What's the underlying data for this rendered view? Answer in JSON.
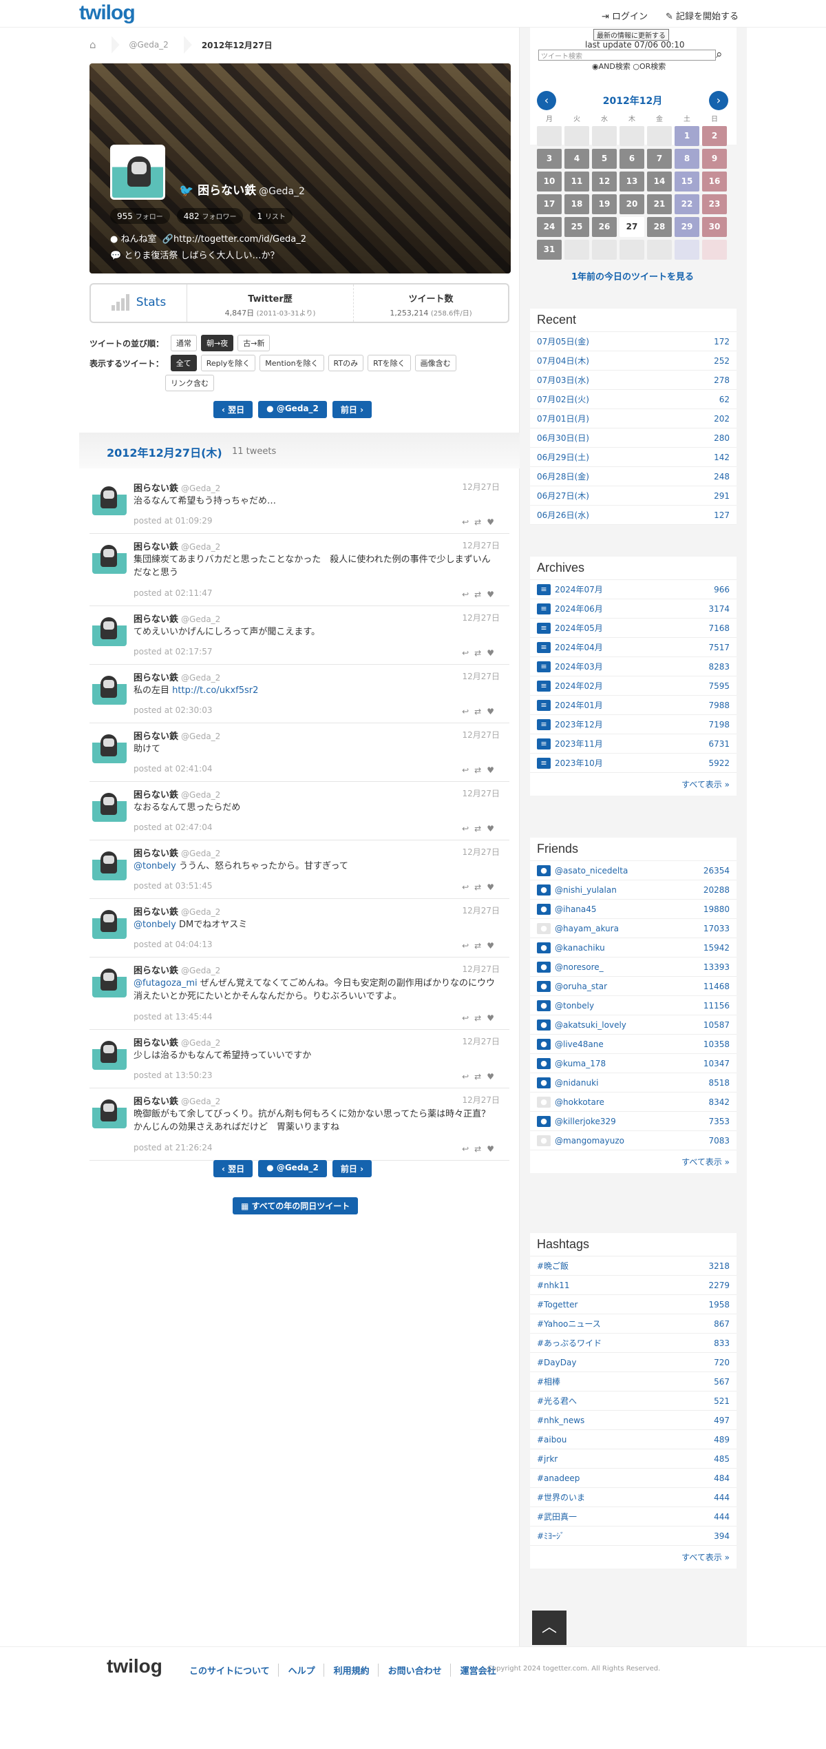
{
  "header": {
    "logo": "twilog",
    "login": "ログイン",
    "start": "記録を開始する"
  },
  "breadcrumb": {
    "user": "@Geda_2",
    "date": "2012年12月27日"
  },
  "profile": {
    "name": "困らない鉄",
    "handle": "@Geda_2",
    "followers_count": "955",
    "followers_label": "フォロー",
    "following_count": "482",
    "following_label": "フォロワー",
    "lists_count": "1",
    "lists_label": "リスト",
    "location": "ねんね室",
    "url": "http://togetter.com/id/Geda_2",
    "bio": "とりま復活祭 しばらく大人しい…か？"
  },
  "stats": {
    "label": "Stats",
    "history_title": "Twitter歴",
    "history_value": "4,847日",
    "history_note": "(2011-03-31より)",
    "count_title": "ツイート数",
    "count_value": "1,253,214",
    "count_note": "(258.6件/日)"
  },
  "options": {
    "order_label": "ツイートの並び順：",
    "order": [
      "通常",
      "朝→夜",
      "古→新"
    ],
    "filter_label": "表示するツイート：",
    "filters": [
      "全て",
      "Replyを除く",
      "Mentionを除く",
      "RTのみ",
      "RTを除く",
      "画像含む",
      "リンク含む"
    ]
  },
  "nav": {
    "prev": "翌日",
    "user": "@Geda_2",
    "next": "前日",
    "all_years": "すべての年の同日ツイート"
  },
  "day": {
    "title": "2012年12月27日(木)",
    "count": "11 tweets"
  },
  "tweets": [
    {
      "name": "困らない鉄",
      "handle": "@Geda_2",
      "date": "12月27日",
      "text": "治るなんて希望もう持っちゃだめ…",
      "link": "",
      "time": "posted at 01:09:29"
    },
    {
      "name": "困らない鉄",
      "handle": "@Geda_2",
      "date": "12月27日",
      "text": "集団練炭てあまりバカだと思ったことなかった　殺人に使われた例の事件で少しまずいんだなと思う",
      "link": "",
      "time": "posted at 02:11:47"
    },
    {
      "name": "困らない鉄",
      "handle": "@Geda_2",
      "date": "12月27日",
      "text": "てめえいいかげんにしろって声が聞こえます。",
      "link": "",
      "time": "posted at 02:17:57"
    },
    {
      "name": "困らない鉄",
      "handle": "@Geda_2",
      "date": "12月27日",
      "text": "私の左目",
      "link": "http://t.co/ukxf5sr2",
      "time": "posted at 02:30:03"
    },
    {
      "name": "困らない鉄",
      "handle": "@Geda_2",
      "date": "12月27日",
      "text": "助けて",
      "link": "",
      "time": "posted at 02:41:04"
    },
    {
      "name": "困らない鉄",
      "handle": "@Geda_2",
      "date": "12月27日",
      "text": "なおるなんて思ったらだめ",
      "link": "",
      "time": "posted at 02:47:04"
    },
    {
      "name": "困らない鉄",
      "handle": "@Geda_2",
      "date": "12月27日",
      "mention": "@tonbely",
      "text": "ううん、怒られちゃったから。甘すぎって",
      "link": "",
      "time": "posted at 03:51:45"
    },
    {
      "name": "困らない鉄",
      "handle": "@Geda_2",
      "date": "12月27日",
      "mention": "@tonbely",
      "text": "DMでねオヤスミ",
      "link": "",
      "time": "posted at 04:04:13"
    },
    {
      "name": "困らない鉄",
      "handle": "@Geda_2",
      "date": "12月27日",
      "mention": "@futagoza_mi",
      "text": "ぜんぜん覚えてなくてごめんね。今日も安定剤の副作用ばかりなのにウウ消えたいとか死にたいとかそんなんだから。りむぶろいいですよ。",
      "link": "",
      "time": "posted at 13:45:44"
    },
    {
      "name": "困らない鉄",
      "handle": "@Geda_2",
      "date": "12月27日",
      "text": "少しは治るかもなんて希望持っていいですか",
      "link": "",
      "time": "posted at 13:50:23"
    },
    {
      "name": "困らない鉄",
      "handle": "@Geda_2",
      "date": "12月27日",
      "text": "晩御飯がもて余してびっくり。抗がん剤も何もろくに効かない思ってたら薬は時々正直？かんじんの効果さえあればだけど　胃薬いりますね",
      "link": "",
      "time": "posted at 21:26:24"
    }
  ],
  "sidebar": {
    "update_button": "最新の情報に更新する",
    "last_update": "last update 07/06 00:10",
    "search_placeholder": "ツイート検索",
    "and_search": "AND検索",
    "or_search": "OR検索",
    "calendar": {
      "month": "2012年12月",
      "weekdays": [
        "月",
        "火",
        "水",
        "木",
        "金",
        "土",
        "日"
      ],
      "cells": [
        "",
        "",
        "",
        "",
        "",
        "1",
        "2",
        "3",
        "4",
        "5",
        "6",
        "7",
        "8",
        "9",
        "10",
        "11",
        "12",
        "13",
        "14",
        "15",
        "16",
        "17",
        "18",
        "19",
        "20",
        "21",
        "22",
        "23",
        "24",
        "25",
        "26",
        "27",
        "28",
        "29",
        "30",
        "31",
        "",
        "",
        "",
        "",
        "",
        ""
      ],
      "year_ago": "1年前の今日のツイートを見る"
    },
    "recent_title": "Recent",
    "recent": [
      {
        "label": "07月05日(金)",
        "count": "172"
      },
      {
        "label": "07月04日(木)",
        "count": "252"
      },
      {
        "label": "07月03日(水)",
        "count": "278"
      },
      {
        "label": "07月02日(火)",
        "count": "62"
      },
      {
        "label": "07月01日(月)",
        "count": "202"
      },
      {
        "label": "06月30日(日)",
        "count": "280"
      },
      {
        "label": "06月29日(土)",
        "count": "142"
      },
      {
        "label": "06月28日(金)",
        "count": "248"
      },
      {
        "label": "06月27日(木)",
        "count": "291"
      },
      {
        "label": "06月26日(水)",
        "count": "127"
      }
    ],
    "archives_title": "Archives",
    "archives": [
      {
        "label": "2024年07月",
        "count": "966"
      },
      {
        "label": "2024年06月",
        "count": "3174"
      },
      {
        "label": "2024年05月",
        "count": "7168"
      },
      {
        "label": "2024年04月",
        "count": "7517"
      },
      {
        "label": "2024年03月",
        "count": "8283"
      },
      {
        "label": "2024年02月",
        "count": "7595"
      },
      {
        "label": "2024年01月",
        "count": "7988"
      },
      {
        "label": "2023年12月",
        "count": "7198"
      },
      {
        "label": "2023年11月",
        "count": "6731"
      },
      {
        "label": "2023年10月",
        "count": "5922"
      }
    ],
    "show_all": "すべて表示 »",
    "friends_title": "Friends",
    "friends": [
      {
        "label": "@asato_nicedelta",
        "count": "26354"
      },
      {
        "label": "@nishi_yulalan",
        "count": "20288"
      },
      {
        "label": "@ihana45",
        "count": "19880"
      },
      {
        "label": "@hayam_akura",
        "count": "17033"
      },
      {
        "label": "@kanachiku",
        "count": "15942"
      },
      {
        "label": "@noresore_",
        "count": "13393"
      },
      {
        "label": "@oruha_star",
        "count": "11468"
      },
      {
        "label": "@tonbely",
        "count": "11156"
      },
      {
        "label": "@akatsuki_lovely",
        "count": "10587"
      },
      {
        "label": "@live48ane",
        "count": "10358"
      },
      {
        "label": "@kuma_178",
        "count": "10347"
      },
      {
        "label": "@nidanuki",
        "count": "8518"
      },
      {
        "label": "@hokkotare",
        "count": "8342"
      },
      {
        "label": "@killerjoke329",
        "count": "7353"
      },
      {
        "label": "@mangomayuzo",
        "count": "7083"
      }
    ],
    "hashtags_title": "Hashtags",
    "hashtags": [
      {
        "label": "#晩ご飯",
        "count": "3218"
      },
      {
        "label": "#nhk11",
        "count": "2279"
      },
      {
        "label": "#Togetter",
        "count": "1958"
      },
      {
        "label": "#Yahooニュース",
        "count": "867"
      },
      {
        "label": "#あっぷるワイド",
        "count": "833"
      },
      {
        "label": "#DayDay",
        "count": "720"
      },
      {
        "label": "#相棒",
        "count": "567"
      },
      {
        "label": "#光る君へ",
        "count": "521"
      },
      {
        "label": "#nhk_news",
        "count": "497"
      },
      {
        "label": "#aibou",
        "count": "489"
      },
      {
        "label": "#jrkr",
        "count": "485"
      },
      {
        "label": "#anadeep",
        "count": "484"
      },
      {
        "label": "#世界のいま",
        "count": "444"
      },
      {
        "label": "#武田真一",
        "count": "444"
      },
      {
        "label": "#ﾐﾖｰｼﾞ",
        "count": "394"
      }
    ]
  },
  "footer": {
    "logo": "twilog",
    "links": [
      "このサイトについて",
      "ヘルプ",
      "利用規約",
      "お問い合わせ",
      "運営会社"
    ],
    "copyright": "Copyright 2024 togetter.com. All Rights Reserved."
  }
}
